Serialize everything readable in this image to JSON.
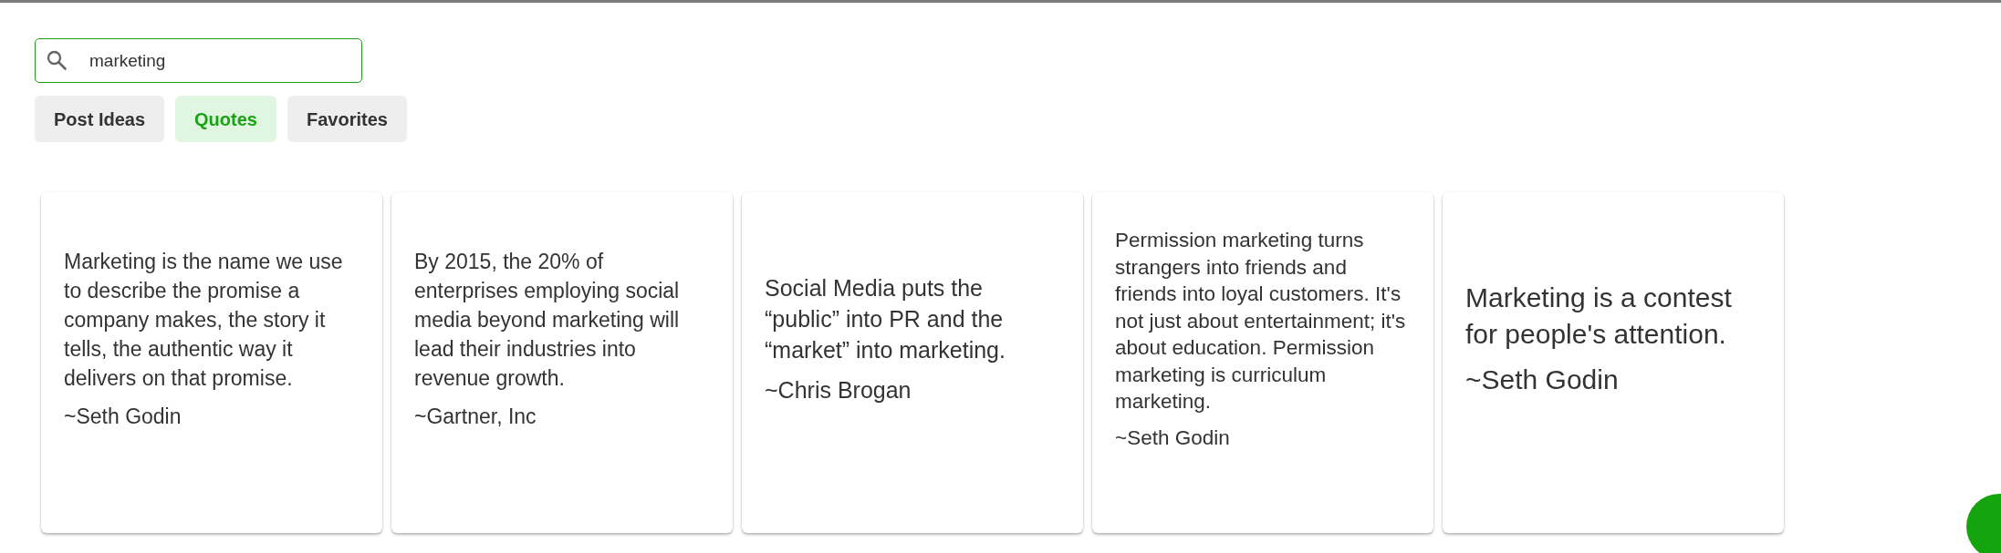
{
  "search": {
    "value": "marketing"
  },
  "tabs": [
    {
      "label": "Post Ideas",
      "selected": false
    },
    {
      "label": "Quotes",
      "selected": true
    },
    {
      "label": "Favorites",
      "selected": false
    }
  ],
  "quotes": [
    {
      "text": "Marketing is the name we use to describe the promise a company makes, the story it tells, the authentic way it delivers on that promise.",
      "author": "~Seth Godin"
    },
    {
      "text": "By 2015, the 20% of enterprises employing social media beyond marketing will lead their industries into revenue growth.",
      "author": "~Gartner, Inc"
    },
    {
      "text": "Social Media puts the “public” into PR and the “market” into marketing.",
      "author": "~Chris Brogan"
    },
    {
      "text": "Permission marketing turns strangers into friends and friends into loyal customers. It's not just about entertainment; it's about education. Permission marketing is curriculum marketing.",
      "author": "~Seth Godin"
    },
    {
      "text": "Marketing is a contest for people's attention.",
      "author": "~Seth Godin"
    }
  ]
}
